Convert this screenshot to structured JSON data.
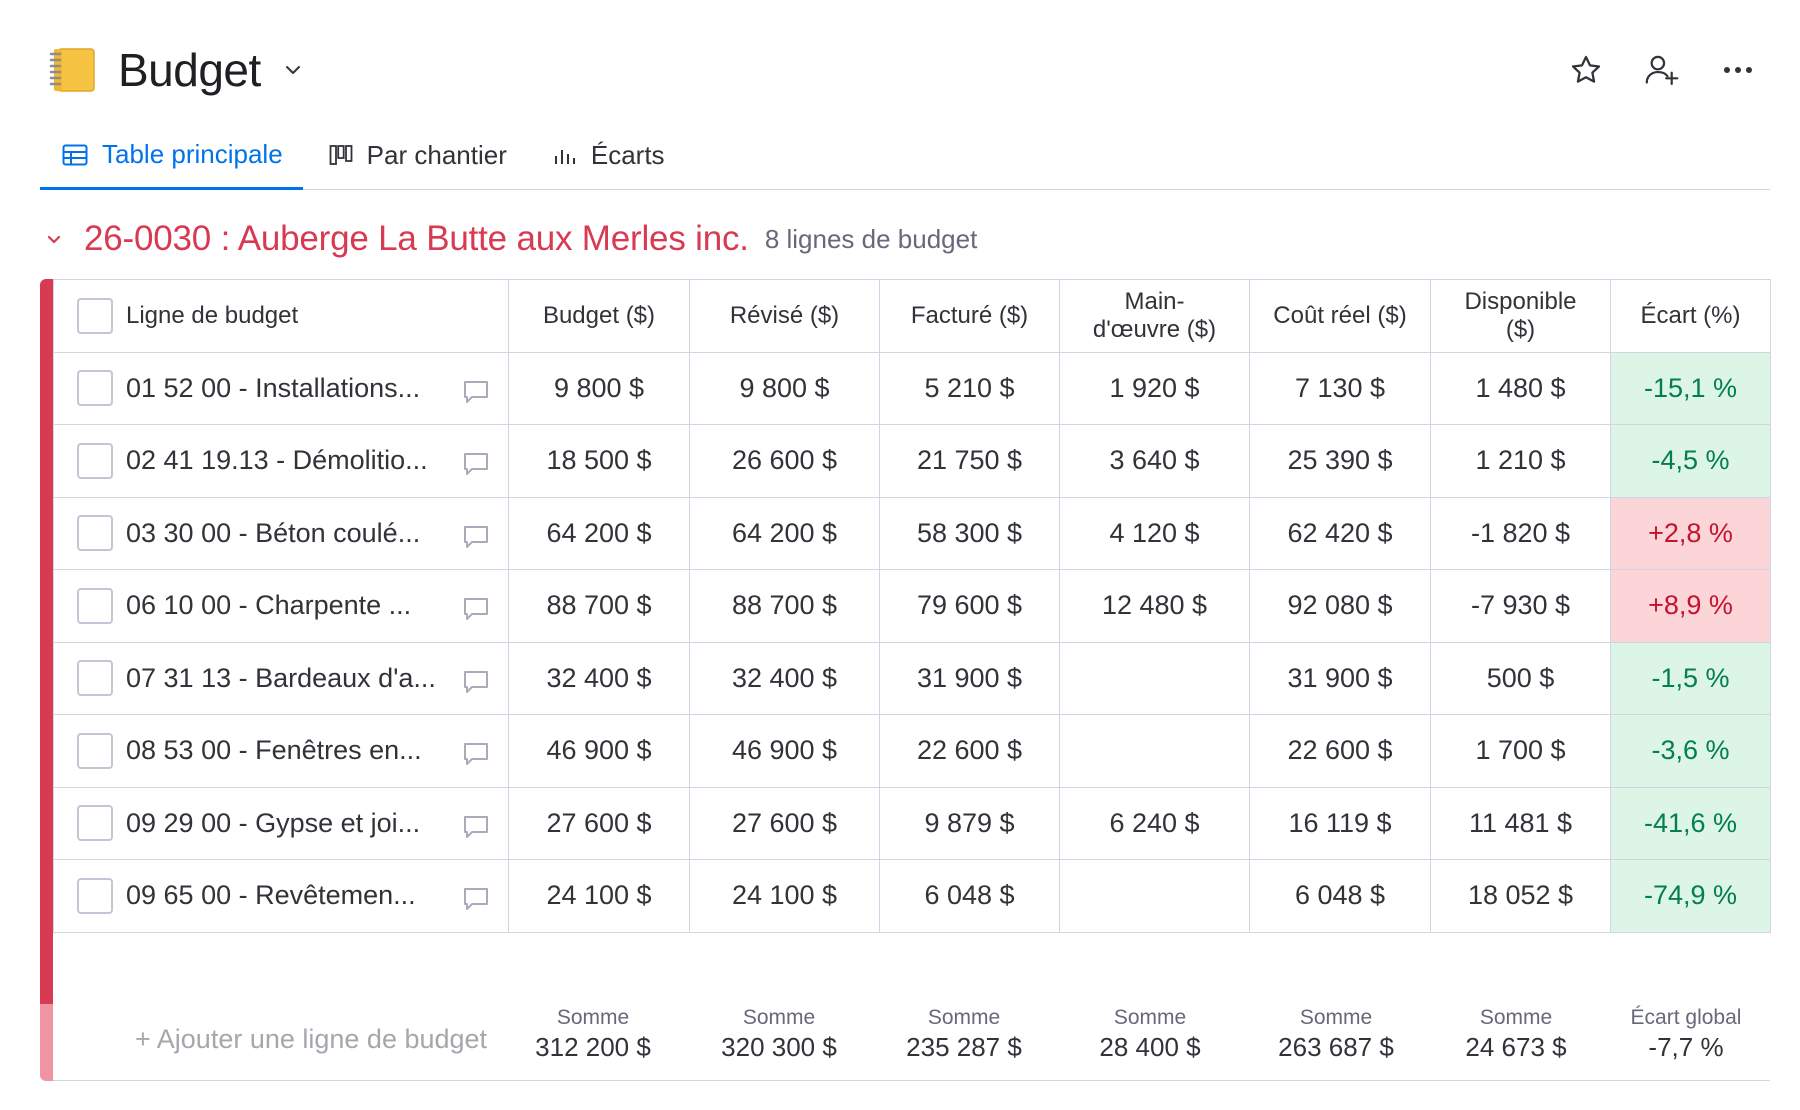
{
  "board": {
    "title": "Budget"
  },
  "tabs": [
    {
      "label": "Table principale",
      "active": true,
      "icon": "table-icon"
    },
    {
      "label": "Par chantier",
      "active": false,
      "icon": "kanban-icon"
    },
    {
      "label": "Écarts",
      "active": false,
      "icon": "chart-icon"
    }
  ],
  "group": {
    "title": "26-0030 : Auberge La Butte aux Merles inc.",
    "count": "8 lignes de budget",
    "color": "#d83a52"
  },
  "columns": {
    "name": "Ligne de budget",
    "budget": "Budget ($)",
    "revise": "Révisé ($)",
    "facture": "Facturé ($)",
    "main_oeuvre_1": "Main-",
    "main_oeuvre_2": "d'œuvre ($)",
    "cout": "Coût réel ($)",
    "disponible_1": "Disponible",
    "disponible_2": "($)",
    "ecart": "Écart (%)"
  },
  "rows": [
    {
      "name": "01 52 00 - Installations...",
      "budget": "9 800 $",
      "revise": "9 800 $",
      "facture": "5 210 $",
      "main": "1 920 $",
      "cout": "7 130 $",
      "dispo": "1 480 $",
      "ecart": "-15,1 %",
      "status": "positive"
    },
    {
      "name": "02 41 19.13 - Démolitio...",
      "budget": "18 500 $",
      "revise": "26 600 $",
      "facture": "21 750 $",
      "main": "3 640 $",
      "cout": "25 390 $",
      "dispo": "1 210 $",
      "ecart": "-4,5 %",
      "status": "positive"
    },
    {
      "name": "03 30 00 - Béton coulé...",
      "budget": "64 200 $",
      "revise": "64 200 $",
      "facture": "58 300 $",
      "main": "4 120 $",
      "cout": "62 420 $",
      "dispo": "-1 820 $",
      "ecart": "+2,8 %",
      "status": "negative"
    },
    {
      "name": "06 10 00 - Charpente ...",
      "budget": "88 700 $",
      "revise": "88 700 $",
      "facture": "79 600 $",
      "main": "12 480 $",
      "cout": "92 080 $",
      "dispo": "-7 930 $",
      "ecart": "+8,9 %",
      "status": "negative"
    },
    {
      "name": "07 31 13 - Bardeaux d'a...",
      "budget": "32 400 $",
      "revise": "32 400 $",
      "facture": "31 900 $",
      "main": "",
      "cout": "31 900 $",
      "dispo": "500 $",
      "ecart": "-1,5 %",
      "status": "positive"
    },
    {
      "name": "08 53 00 - Fenêtres en...",
      "budget": "46 900 $",
      "revise": "46 900 $",
      "facture": "22 600 $",
      "main": "",
      "cout": "22 600 $",
      "dispo": "1 700 $",
      "ecart": "-3,6 %",
      "status": "positive"
    },
    {
      "name": "09 29 00 - Gypse et joi...",
      "budget": "27 600 $",
      "revise": "27 600 $",
      "facture": "9 879 $",
      "main": "6 240 $",
      "cout": "16 119 $",
      "dispo": "11 481 $",
      "ecart": "-41,6 %",
      "status": "positive"
    },
    {
      "name": "09 65 00 - Revêtemen...",
      "budget": "24 100 $",
      "revise": "24 100 $",
      "facture": "6 048 $",
      "main": "",
      "cout": "6 048 $",
      "dispo": "18 052 $",
      "ecart": "-74,9 %",
      "status": "positive"
    }
  ],
  "add_row": "+ Ajouter une ligne de budget",
  "summary": [
    {
      "label": "Somme",
      "value": "312 200 $"
    },
    {
      "label": "Somme",
      "value": "320 300 $"
    },
    {
      "label": "Somme",
      "value": "235 287 $"
    },
    {
      "label": "Somme",
      "value": "28 400 $"
    },
    {
      "label": "Somme",
      "value": "263 687 $"
    },
    {
      "label": "Somme",
      "value": "24 673 $"
    },
    {
      "label": "Écart global",
      "value": "-7,7 %"
    }
  ],
  "colors": {
    "accent": "#0073ea",
    "group": "#d83a52",
    "positive_bg": "#dcf5e7",
    "positive_text": "#037f4c",
    "negative_bg": "#fcd5d8",
    "negative_text": "#c4122f"
  }
}
